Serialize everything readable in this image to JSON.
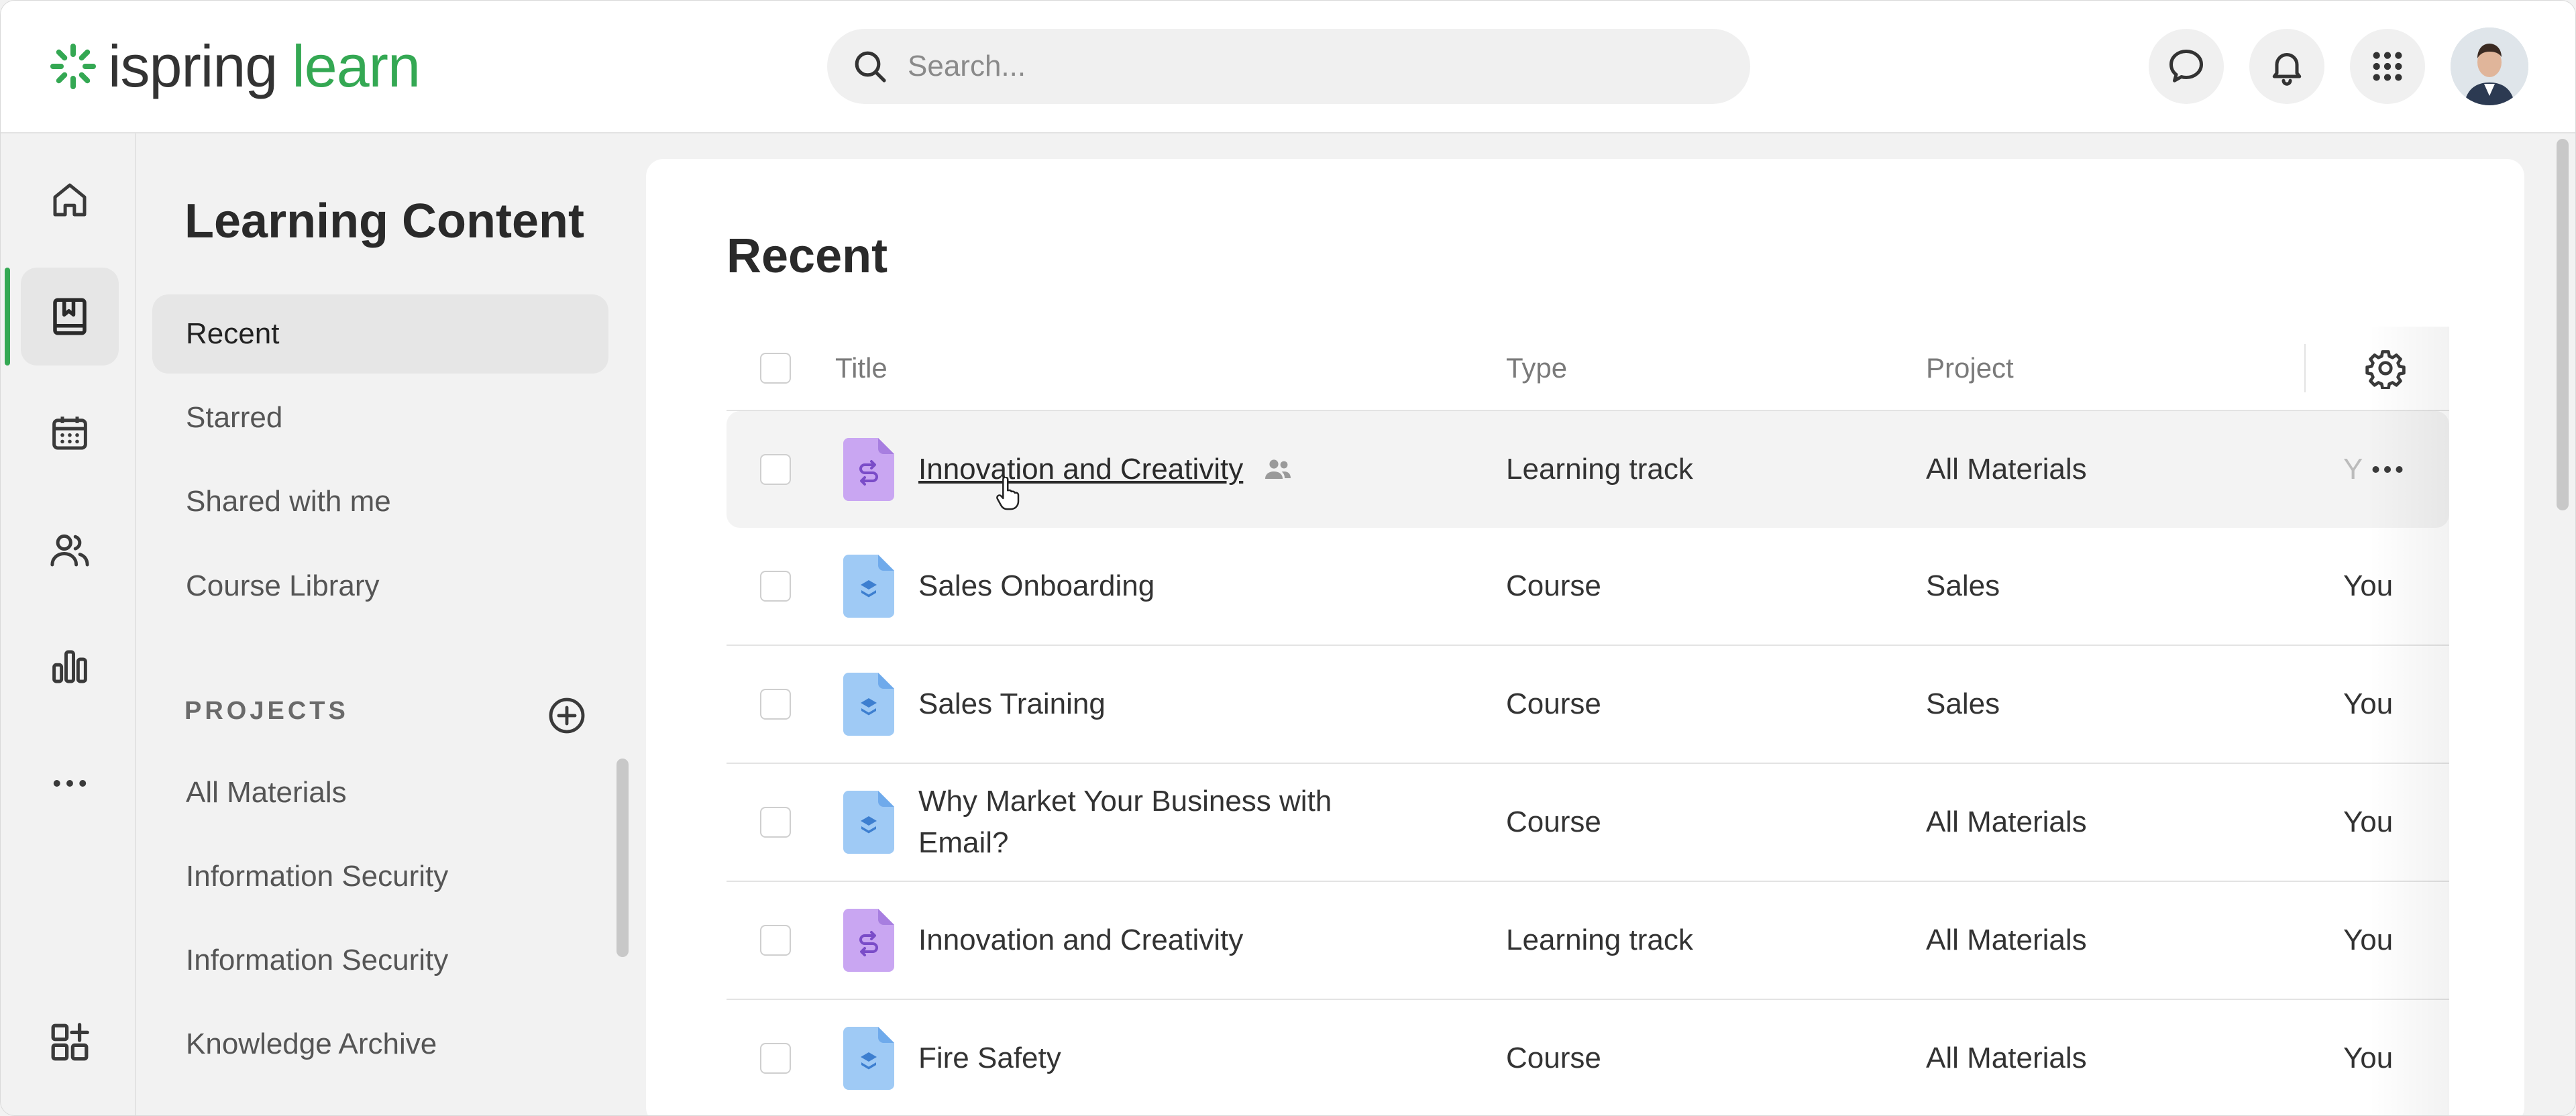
{
  "brand": {
    "word1": "ispring",
    "word2": "learn",
    "accent": "#34a853"
  },
  "search": {
    "placeholder": "Search..."
  },
  "header_icons": [
    "chat-icon",
    "bell-icon",
    "apps-grid-icon"
  ],
  "rail": [
    "home-icon",
    "book-icon",
    "calendar-icon",
    "users-icon",
    "chart-icon",
    "more-icon",
    "add-widget-icon"
  ],
  "sidebar": {
    "title": "Learning Content",
    "items": [
      {
        "label": "Recent",
        "active": true
      },
      {
        "label": "Starred"
      },
      {
        "label": "Shared with me"
      },
      {
        "label": "Course Library"
      }
    ],
    "projects_header": "PROJECTS",
    "projects": [
      "All Materials",
      "Information Security",
      "Information Security",
      "Knowledge Archive"
    ]
  },
  "main": {
    "title": "Recent",
    "columns": {
      "title": "Title",
      "type": "Type",
      "project": "Project"
    },
    "rows": [
      {
        "title": "Innovation and Creativity",
        "kind": "track",
        "type": "Learning track",
        "project": "All Materials",
        "author": "Y",
        "shared": true,
        "hover": true
      },
      {
        "title": "Sales Onboarding",
        "kind": "course",
        "type": "Course",
        "project": "Sales",
        "author": "You"
      },
      {
        "title": "Sales Training",
        "kind": "course",
        "type": "Course",
        "project": "Sales",
        "author": "You"
      },
      {
        "title": "Why Market Your Business with Email?",
        "kind": "course",
        "type": "Course",
        "project": "All Materials",
        "author": "You"
      },
      {
        "title": "Innovation and Creativity",
        "kind": "track",
        "type": "Learning track",
        "project": "All Materials",
        "author": "You"
      },
      {
        "title": "Fire Safety",
        "kind": "course",
        "type": "Course",
        "project": "All Materials",
        "author": "You"
      }
    ]
  }
}
